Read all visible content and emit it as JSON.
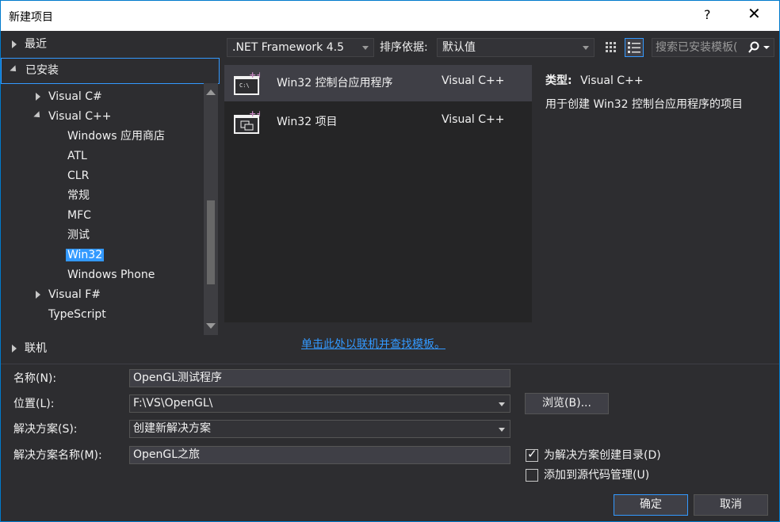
{
  "window": {
    "title": "新建项目",
    "help": "?",
    "close": "✕"
  },
  "tree": {
    "recent": "最近",
    "installed": "已安装",
    "items": [
      "Visual C#",
      "Visual C++",
      "Windows 应用商店",
      "ATL",
      "CLR",
      "常规",
      "MFC",
      "测试",
      "Win32",
      "Windows Phone",
      "Visual F#",
      "TypeScript"
    ],
    "online": "联机"
  },
  "toolbar": {
    "framework": ".NET Framework 4.5",
    "sort_label": "排序依据:",
    "sort_value": "默认值",
    "search_placeholder": "搜索已安装模板(",
    "search_icon": "ρ"
  },
  "templates": [
    {
      "name": "Win32 控制台应用程序",
      "lang": "Visual C++"
    },
    {
      "name": "Win32 项目",
      "lang": "Visual C++"
    }
  ],
  "description": {
    "type_label": "类型:",
    "type_value": "Visual C++",
    "text": "用于创建 Win32 控制台应用程序的项目"
  },
  "online_link": "单击此处以联机并查找模板。",
  "form": {
    "name_label": "名称(N):",
    "name_value": "OpenGL测试程序",
    "location_label": "位置(L):",
    "location_value": "F:\\VS\\OpenGL\\",
    "solution_label": "解决方案(S):",
    "solution_value": "创建新解决方案",
    "solution_name_label": "解决方案名称(M):",
    "solution_name_value": "OpenGL之旅",
    "browse": "浏览(B)...",
    "create_dir": "为解决方案创建目录(D)",
    "add_source": "添加到源代码管理(U)",
    "ok": "确定",
    "cancel": "取消"
  }
}
